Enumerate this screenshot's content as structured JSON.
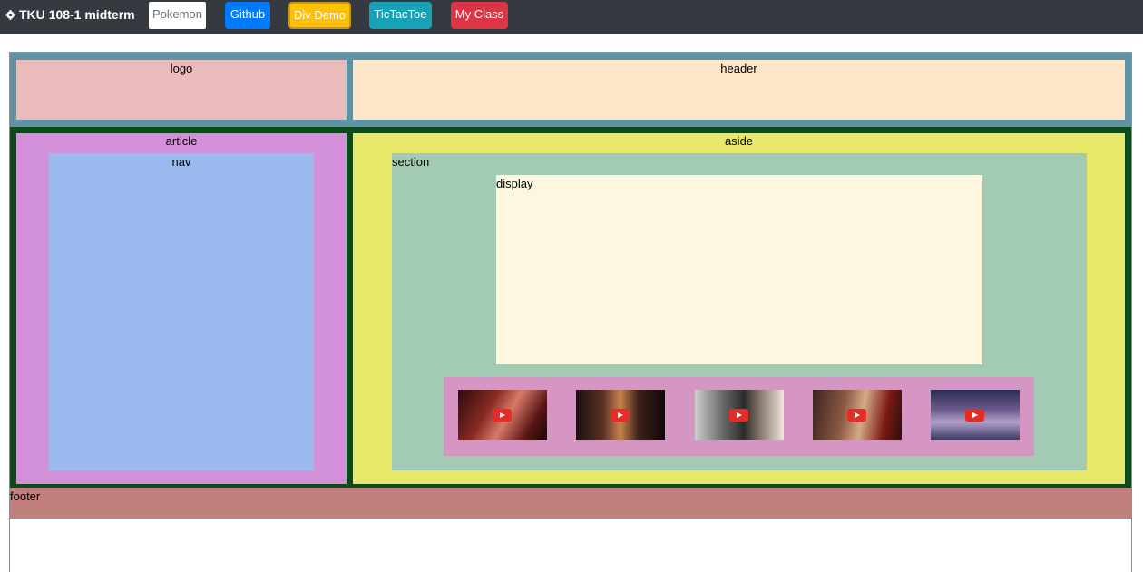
{
  "navbar": {
    "brand": "TKU 108-1 midterm",
    "brand_icon": "gear-icon",
    "buttons": [
      {
        "label": "Pokemon",
        "color": "#ffffff"
      },
      {
        "label": "Github",
        "color": "#007bff"
      },
      {
        "label": "Div Demo",
        "color": "#ffc107"
      },
      {
        "label": "TicTacToe",
        "color": "#17a2b8"
      },
      {
        "label": "My Class",
        "color": "#dc3545"
      }
    ]
  },
  "layout": {
    "logo": "logo",
    "header": "header",
    "article": "article",
    "nav": "nav",
    "aside": "aside",
    "section": "section",
    "display": "display",
    "footer": "footer"
  },
  "videos": [
    {
      "icon": "youtube-play-icon"
    },
    {
      "icon": "youtube-play-icon"
    },
    {
      "icon": "youtube-play-icon"
    },
    {
      "icon": "youtube-play-icon"
    },
    {
      "icon": "youtube-play-icon"
    }
  ]
}
